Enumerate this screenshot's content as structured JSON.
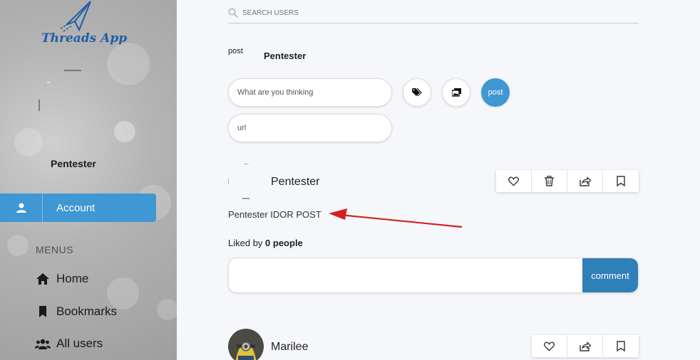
{
  "app": {
    "name": "Threads App"
  },
  "sidebar": {
    "username": "Pentester",
    "account_label": "Account",
    "menus_label": "MENUS",
    "items": [
      {
        "label": "Home",
        "icon": "home-icon"
      },
      {
        "label": "Bookmarks",
        "icon": "bookmark-icon"
      },
      {
        "label": "All users",
        "icon": "users-icon"
      }
    ]
  },
  "search": {
    "placeholder": "SEARCH USERS"
  },
  "composer": {
    "label": "post",
    "username": "Pentester",
    "text_placeholder": "What are you thinking",
    "url_placeholder": "url",
    "post_button": "post"
  },
  "posts": [
    {
      "username": "Pentester",
      "text": "Pentester IDOR POST",
      "liked_by_prefix": "Liked by",
      "liked_by_count": "0 people",
      "comment_button": "comment"
    },
    {
      "username": "Marilee"
    }
  ],
  "colors": {
    "accent": "#3f97d3",
    "comment_button": "#2f7fb8",
    "arrow": "#d32020"
  }
}
